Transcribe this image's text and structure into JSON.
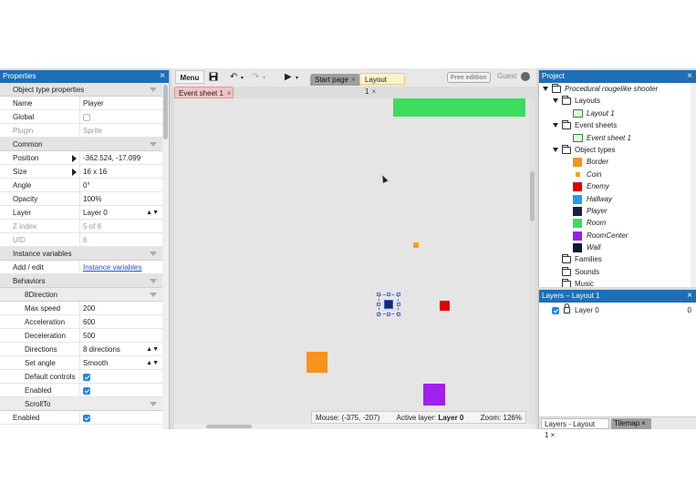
{
  "toolbar": {
    "menu_label": "Menu",
    "save_icon": "save-icon",
    "tabs": [
      {
        "label": "Start page",
        "close": "×"
      },
      {
        "label": "Layout 1",
        "close": "×"
      }
    ],
    "free_edition": "Free edition",
    "guest": "Guest"
  },
  "event_tab": {
    "label": "Event sheet 1",
    "close": "×"
  },
  "properties": {
    "title": "Properties",
    "close": "×",
    "sections": {
      "object_type_properties": "Object type properties",
      "common": "Common",
      "instance_variables": "Instance variables",
      "behaviors": "Behaviors",
      "eight_direction": "8Direction",
      "scroll_to": "ScrollTo"
    },
    "rows": {
      "name": {
        "k": "Name",
        "v": "Player"
      },
      "global": {
        "k": "Global"
      },
      "plugin": {
        "k": "Plugin",
        "v": "Sprite"
      },
      "position": {
        "k": "Position",
        "v": "-362.524, -17.099"
      },
      "size": {
        "k": "Size",
        "v": "16 x 16"
      },
      "angle": {
        "k": "Angle",
        "v": "0°"
      },
      "opacity": {
        "k": "Opacity",
        "v": "100%"
      },
      "layer": {
        "k": "Layer",
        "v": "Layer 0"
      },
      "zindex": {
        "k": "Z index",
        "v": "5 of 8"
      },
      "uid": {
        "k": "UID",
        "v": "6"
      },
      "add_edit": {
        "k": "Add / edit",
        "v": "Instance variables"
      },
      "max_speed": {
        "k": "Max speed",
        "v": "200"
      },
      "acceleration": {
        "k": "Acceleration",
        "v": "600"
      },
      "deceleration": {
        "k": "Deceleration",
        "v": "500"
      },
      "directions": {
        "k": "Directions",
        "v": "8 directions"
      },
      "set_angle": {
        "k": "Set angle",
        "v": "Smooth"
      },
      "default_controls": {
        "k": "Default controls"
      },
      "enabled_8dir": {
        "k": "Enabled"
      },
      "enabled_scroll": {
        "k": "Enabled"
      }
    }
  },
  "canvas": {
    "status": {
      "mouse": "Mouse: (-375, -207)",
      "active_layer_label": "Active layer:",
      "active_layer": "Layer 0",
      "zoom": "Zoom: 126%"
    },
    "colors": {
      "room": "#3ddc5f",
      "border": "#f7931e",
      "enemy": "#e00000",
      "roomcenter": "#a020f0",
      "coin": "#f5a800",
      "player": "#1c2a5c"
    }
  },
  "project": {
    "title": "Project",
    "close": "×",
    "root": "Procedural rougelike shooter",
    "layouts": "Layouts",
    "layout1": "Layout 1",
    "event_sheets": "Event sheets",
    "event_sheet1": "Event sheet 1",
    "object_types": "Object types",
    "objects": [
      {
        "name": "Border",
        "color": "#f7931e"
      },
      {
        "name": "Coin",
        "color": "#f5a800"
      },
      {
        "name": "Enemy",
        "color": "#e00000"
      },
      {
        "name": "Hallway",
        "color": "#1e9ee8"
      },
      {
        "name": "Player",
        "color": "#16243e"
      },
      {
        "name": "Room",
        "color": "#3ddc5f"
      },
      {
        "name": "RoomCenter",
        "color": "#9b1ee8"
      },
      {
        "name": "Wall",
        "color": "#0e1a2e"
      }
    ],
    "families": "Families",
    "sounds": "Sounds",
    "music": "Music"
  },
  "layers": {
    "title": "Layers – Layout 1",
    "close": "×",
    "layer_name": "Layer 0",
    "layer_index": "0",
    "tab_layers": "Layers - Layout 1",
    "tab_tilemap": "Tilemap",
    "tab_close": "×"
  }
}
